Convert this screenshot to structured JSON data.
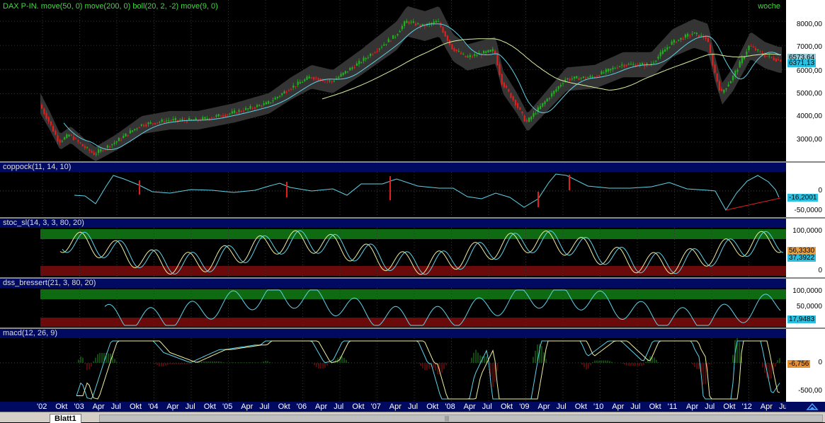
{
  "price": {
    "title": "DAX P-IN. move(50, 0) move(200, 0) boll(20, 2, -2) move(9, 0)",
    "period": "woche",
    "ticks": [
      "8000,00",
      "7000,00",
      "6000,00",
      "5000,00",
      "4000,00",
      "3000,00"
    ],
    "last_labels": [
      "6573,64",
      "6371,13"
    ]
  },
  "coppock": {
    "title": "coppock(11, 14, 10)",
    "ticks": [
      "0",
      "-50,0000"
    ],
    "last": "-16,2001"
  },
  "stoc": {
    "title": "stoc_sl(14, 3, 3, 80, 20)",
    "ticks": [
      "100,0000",
      "0"
    ],
    "last_labels": [
      "56,3330",
      "37,3922"
    ]
  },
  "dss": {
    "title": "dss_bressert(21, 3, 80, 20)",
    "ticks": [
      "100,0000",
      "50,0000"
    ],
    "last": "17,9483"
  },
  "macd": {
    "title": "macd(12, 26, 9)",
    "ticks": [
      "0",
      "-500,00"
    ],
    "last": "-6,756"
  },
  "xaxis": [
    "'02",
    "Okt",
    "'03",
    "Apr",
    "Jul",
    "Okt",
    "'04",
    "Apr",
    "Jul",
    "Okt",
    "'05",
    "Apr",
    "Jul",
    "Okt",
    "'06",
    "Apr",
    "Jul",
    "Okt",
    "'07",
    "Apr",
    "Jul",
    "Okt",
    "'08",
    "Apr",
    "Jul",
    "Okt",
    "'09",
    "Apr",
    "Jul",
    "Okt",
    "'10",
    "Apr",
    "Jul",
    "Okt",
    "'11",
    "Apr",
    "Jul",
    "Okt",
    "'12",
    "Apr",
    "Jul"
  ],
  "sheet_tab": "Blatt1",
  "colors": {
    "title_bg": "#000a60",
    "green_zone": "#0e6b12",
    "red_zone": "#6b0a0a",
    "cyan": "#5fd3e8",
    "yellow": "#f0f0a0",
    "candle_up": "#1fb21f",
    "candle_down": "#e11f1f"
  }
}
